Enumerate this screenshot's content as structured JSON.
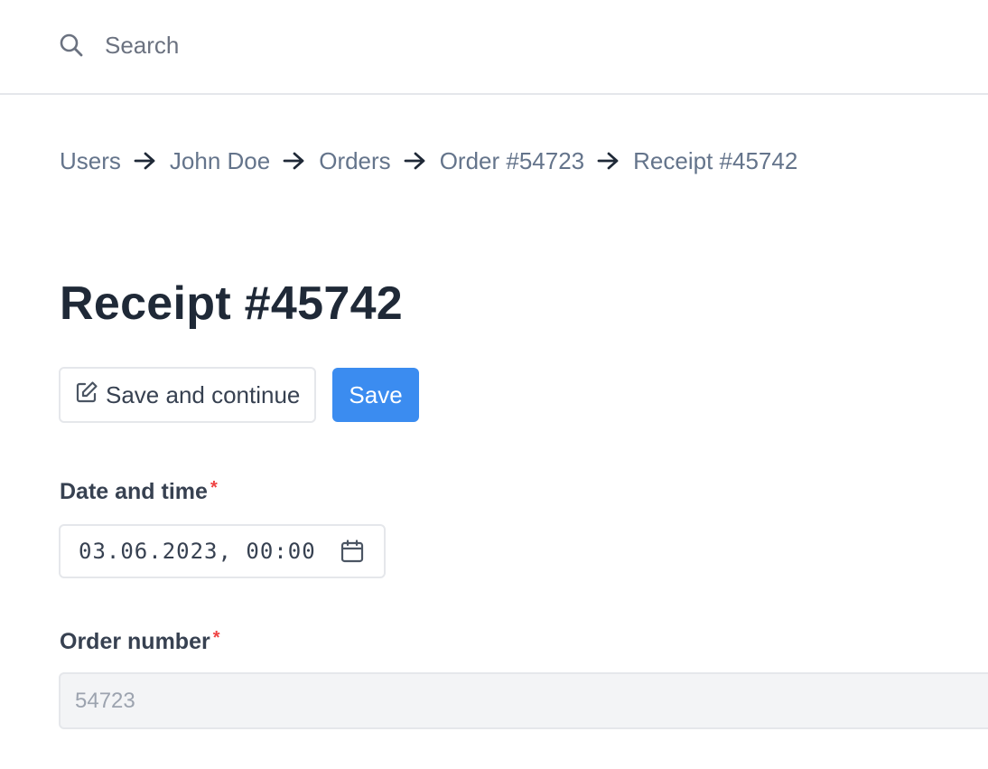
{
  "search": {
    "placeholder": "Search"
  },
  "breadcrumb": [
    "Users",
    "John Doe",
    "Orders",
    "Order #54723",
    "Receipt #45742"
  ],
  "page_title": "Receipt #45742",
  "actions": {
    "save_and_continue": "Save and continue",
    "save": "Save"
  },
  "fields": {
    "datetime": {
      "label": "Date and time",
      "required_mark": "*",
      "value": "03.06.2023, 00:00"
    },
    "order_number": {
      "label": "Order number",
      "required_mark": "*",
      "value": "54723",
      "disabled": true
    }
  },
  "icons": {
    "search": "search-icon",
    "arrow": "arrow-right-icon",
    "edit": "edit-icon",
    "calendar": "calendar-icon"
  },
  "colors": {
    "primary": "#3b8cf0",
    "required": "#ef4444",
    "breadcrumb": "#64748b",
    "disabled_bg": "#f3f4f6"
  }
}
